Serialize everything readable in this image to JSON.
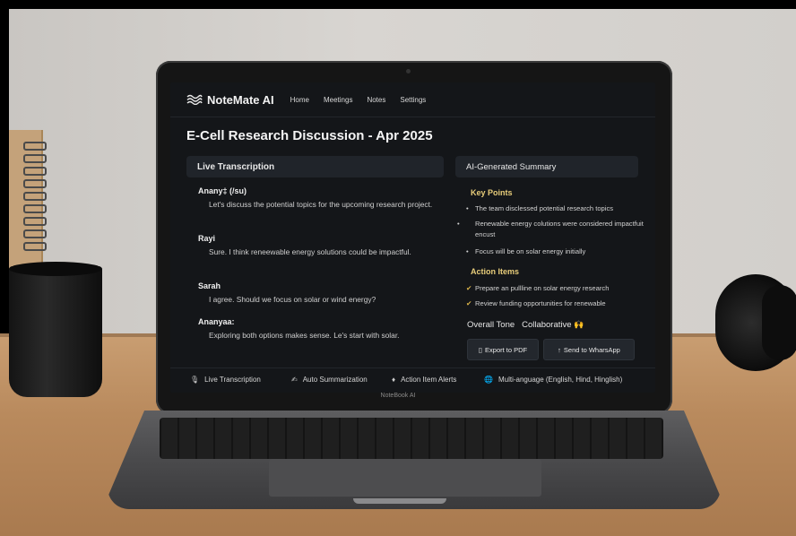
{
  "app": {
    "name": "NoteMate AI",
    "nav": [
      "Home",
      "Meetings",
      "Notes",
      "Settings"
    ]
  },
  "page_title": "E-Cell Research Discussion - Apr 2025",
  "transcription": {
    "header": "Live Transcription",
    "entries": [
      {
        "speaker": "Anany‡ (/su)",
        "text": "Let's discuss the potential topics for the upcoming research project."
      },
      {
        "speaker": "Rayi",
        "text": "Sure.  I think reneewable energy solutions could be impactful."
      },
      {
        "speaker": "Sarah",
        "text": "I agree.  Should we focus on solar or wind energy?"
      },
      {
        "speaker": "Ananyaa:",
        "text": "Exploring both options makes sense. Le's start with solar."
      }
    ]
  },
  "summary": {
    "header": "AI-Generated Summary",
    "key_points_title": "Key Points",
    "key_points": [
      "The team disclessed potential research topics",
      "Renewable energy colutions were considered impactfuit encust",
      "Focus will be on solar energy initially"
    ],
    "action_items_title": "Action Items",
    "action_items": [
      "Prepare an pullline on solar energy research",
      "Review funding opportunities for renewable"
    ],
    "tone_label": "Overall Tone",
    "tone_value": "Collaborative",
    "tone_emoji": "🙌",
    "export_button": "Export to PDF",
    "send_button": "Send to WharsApp"
  },
  "features": [
    {
      "icon": "mic-icon",
      "glyph": "🎙",
      "label": "Live Transcription"
    },
    {
      "icon": "pen-icon",
      "glyph": "✍",
      "label": "Auto Summarization"
    },
    {
      "icon": "bell-icon",
      "glyph": "♦",
      "label": "Action Item Alerts"
    },
    {
      "icon": "globe-icon",
      "glyph": "🌐",
      "label": "Multi-anguage (English, Hind, Hinglish)"
    }
  ],
  "device_label": "NoteBook AI",
  "colors": {
    "screen_bg": "#141619",
    "panel_header": "#20242a",
    "section_title": "#e8cd7a",
    "check": "#e0b84a"
  }
}
